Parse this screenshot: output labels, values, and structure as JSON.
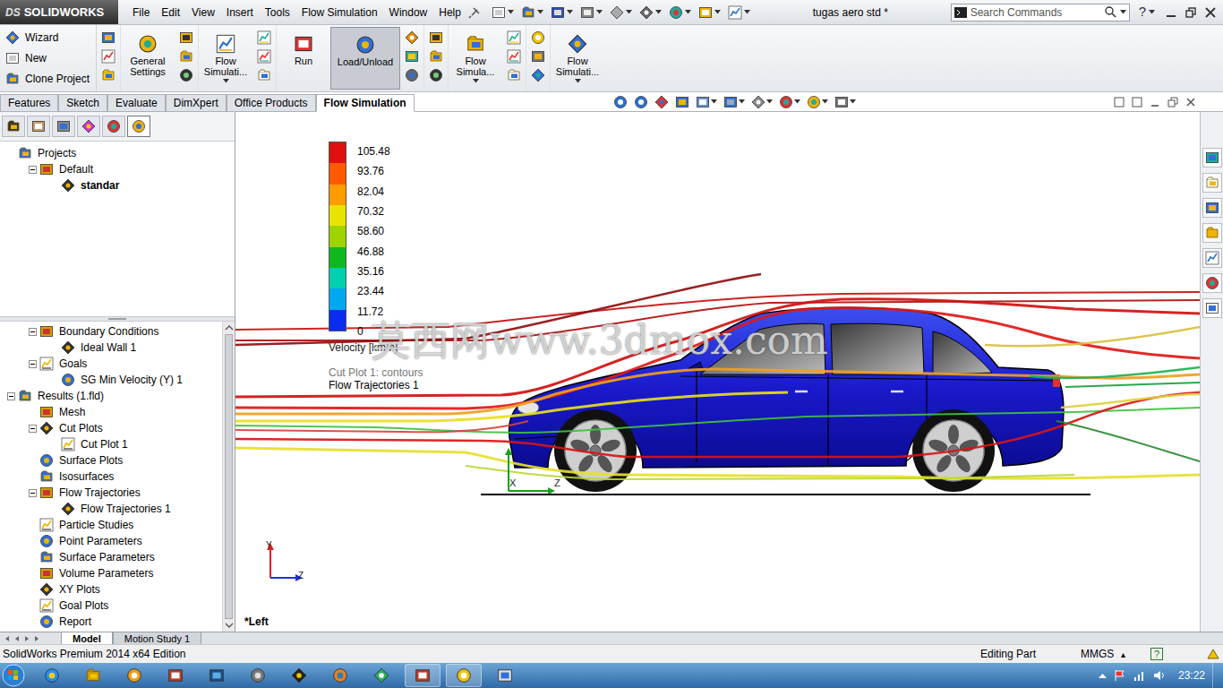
{
  "window": {
    "logo_mark": "DS",
    "logo_text": "SOLIDWORKS",
    "title": "tugas aero std *"
  },
  "menu": [
    "File",
    "Edit",
    "View",
    "Insert",
    "Tools",
    "Flow Simulation",
    "Window",
    "Help"
  ],
  "search": {
    "placeholder": "Search Commands"
  },
  "title_help": "?",
  "project_actions": [
    {
      "label": "Wizard"
    },
    {
      "label": "New"
    },
    {
      "label": "Clone Project"
    }
  ],
  "command_groups": [
    {
      "kind": "icons"
    },
    {
      "kind": "button",
      "label": "General Settings",
      "pressed": false,
      "dropdown": false
    },
    {
      "kind": "icons"
    },
    {
      "kind": "button",
      "label": "Flow Simulati...",
      "pressed": false,
      "dropdown": true
    },
    {
      "kind": "icons"
    },
    {
      "kind": "button",
      "label": "Run",
      "pressed": false,
      "dropdown": false
    },
    {
      "kind": "button",
      "label": "Load/Unload",
      "pressed": true,
      "dropdown": false
    },
    {
      "kind": "icons"
    },
    {
      "kind": "icons"
    },
    {
      "kind": "button",
      "label": "Flow Simula...",
      "pressed": false,
      "dropdown": true
    },
    {
      "kind": "icons"
    },
    {
      "kind": "icons"
    },
    {
      "kind": "button",
      "label": "Flow Simulati...",
      "pressed": false,
      "dropdown": true
    }
  ],
  "command_tabs": [
    {
      "label": "Features",
      "selected": false
    },
    {
      "label": "Sketch",
      "selected": false
    },
    {
      "label": "Evaluate",
      "selected": false
    },
    {
      "label": "DimXpert",
      "selected": false
    },
    {
      "label": "Office Products",
      "selected": false
    },
    {
      "label": "Flow Simulation",
      "selected": true
    }
  ],
  "panel_tabs": [
    {
      "selected": false
    },
    {
      "selected": false
    },
    {
      "selected": false
    },
    {
      "selected": false
    },
    {
      "selected": false
    },
    {
      "selected": true
    }
  ],
  "project_tree": [
    {
      "label": "Projects",
      "level": 0,
      "kind": "leaf",
      "expanded": true,
      "bold": false
    },
    {
      "label": "Default",
      "level": 1,
      "kind": "folder",
      "expanded": true,
      "bold": false
    },
    {
      "label": "standar",
      "level": 2,
      "kind": "leaf",
      "expanded": false,
      "bold": true
    }
  ],
  "results_tree": [
    {
      "label": "Boundary Conditions",
      "level": 1,
      "kind": "folder",
      "expanded": true,
      "bold": false
    },
    {
      "label": "Ideal Wall 1",
      "level": 2,
      "kind": "leaf",
      "expanded": false,
      "bold": false
    },
    {
      "label": "Goals",
      "level": 1,
      "kind": "folder",
      "expanded": true,
      "bold": false
    },
    {
      "label": "SG Min Velocity (Y) 1",
      "level": 2,
      "kind": "leaf",
      "expanded": false,
      "bold": false
    },
    {
      "label": "Results (1.fld)",
      "level": 0,
      "kind": "folder",
      "expanded": true,
      "bold": false
    },
    {
      "label": "Mesh",
      "level": 1,
      "kind": "leaf",
      "expanded": false,
      "bold": false
    },
    {
      "label": "Cut Plots",
      "level": 1,
      "kind": "folder",
      "expanded": true,
      "bold": false
    },
    {
      "label": "Cut Plot 1",
      "level": 2,
      "kind": "leaf",
      "expanded": false,
      "bold": false
    },
    {
      "label": "Surface Plots",
      "level": 1,
      "kind": "leaf",
      "expanded": false,
      "bold": false
    },
    {
      "label": "Isosurfaces",
      "level": 1,
      "kind": "leaf",
      "expanded": false,
      "bold": false
    },
    {
      "label": "Flow Trajectories",
      "level": 1,
      "kind": "folder",
      "expanded": true,
      "bold": false
    },
    {
      "label": "Flow Trajectories 1",
      "level": 2,
      "kind": "leaf",
      "expanded": false,
      "bold": false
    },
    {
      "label": "Particle Studies",
      "level": 1,
      "kind": "leaf",
      "expanded": false,
      "bold": false
    },
    {
      "label": "Point Parameters",
      "level": 1,
      "kind": "leaf",
      "expanded": false,
      "bold": false
    },
    {
      "label": "Surface Parameters",
      "level": 1,
      "kind": "leaf",
      "expanded": false,
      "bold": false
    },
    {
      "label": "Volume Parameters",
      "level": 1,
      "kind": "leaf",
      "expanded": false,
      "bold": false
    },
    {
      "label": "XY Plots",
      "level": 1,
      "kind": "leaf",
      "expanded": false,
      "bold": false
    },
    {
      "label": "Goal Plots",
      "level": 1,
      "kind": "leaf",
      "expanded": false,
      "bold": false
    },
    {
      "label": "Report",
      "level": 1,
      "kind": "leaf",
      "expanded": false,
      "bold": false
    }
  ],
  "legend": {
    "values": [
      "105.48",
      "93.76",
      "82.04",
      "70.32",
      "58.60",
      "46.88",
      "35.16",
      "23.44",
      "11.72",
      "0"
    ],
    "bands": [
      {
        "color": "#e0100e"
      },
      {
        "color": "#ff5a00"
      },
      {
        "color": "#ff9c00"
      },
      {
        "color": "#e8e400"
      },
      {
        "color": "#9ed400"
      },
      {
        "color": "#10b820"
      },
      {
        "color": "#00d0b0"
      },
      {
        "color": "#00a8f0"
      },
      {
        "color": "#0a2cf0"
      }
    ],
    "title": "Velocity [km/h]"
  },
  "plot_labels": [
    {
      "label": "Cut Plot 1: contours",
      "dim": true
    },
    {
      "label": "Flow Trajectories 1",
      "dim": false
    }
  ],
  "watermark": "莫西网www.3dmox.com",
  "view_label": "*Left",
  "model_axes": [
    "X",
    "Z"
  ],
  "triad_axes": [
    "Y",
    "Z"
  ],
  "bottom_tabs": [
    {
      "label": "Model",
      "selected": true
    },
    {
      "label": "Motion Study 1",
      "selected": false
    }
  ],
  "status_bar": {
    "product": "SolidWorks Premium 2014 x64 Edition",
    "mode": "Editing Part",
    "units": "MMGS",
    "units_arrow": "▴",
    "help": "?"
  },
  "taskbar": {
    "time": "23:22"
  }
}
